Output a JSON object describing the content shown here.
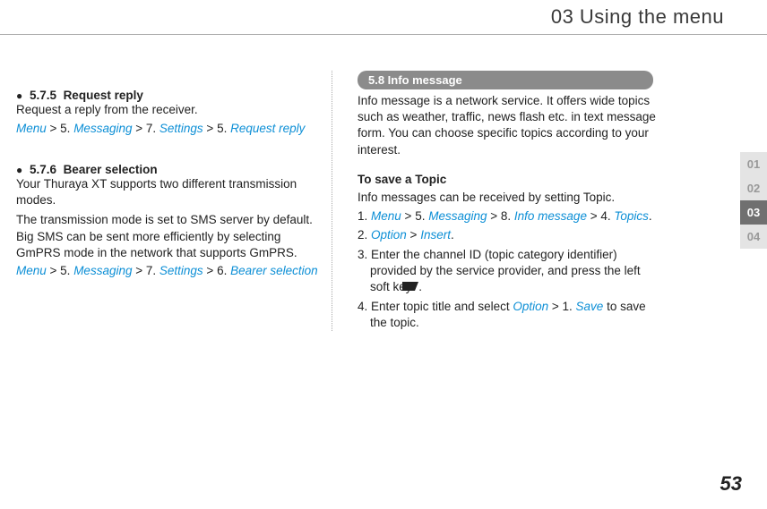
{
  "header": {
    "title": "03 Using the menu"
  },
  "left": {
    "sec575": {
      "num": "5.7.5",
      "title": "Request reply",
      "body": "Request a reply from the receiver.",
      "path": {
        "p1": "Menu",
        "s1": " > ",
        "n1": "5. ",
        "p2": "Messaging",
        "s2": " > ",
        "n2": "7. ",
        "p3": "Settings",
        "s3": " > ",
        "n3": "5. ",
        "p4": "Request reply"
      }
    },
    "sec576": {
      "num": "5.7.6",
      "title": "Bearer selection",
      "body1": "Your Thuraya XT supports two different transmission modes.",
      "body2": "The transmission mode is set to SMS server by default. Big SMS can be sent more efficiently by selecting GmPRS mode in the network that supports GmPRS.",
      "path": {
        "p1": "Menu",
        "s1": " > ",
        "n1": "5. ",
        "p2": "Messaging",
        "s2": " > ",
        "n2": "7. ",
        "p3": "Settings",
        "s3": " > ",
        "n3": "6. ",
        "p4": "Bearer selection"
      }
    }
  },
  "right": {
    "pill": "5.8  Info message",
    "intro": "Info message is a network service. It offers wide topics such as weather, traffic, news flash etc. in text message form. You can choose specific topics according to your interest.",
    "subhead": "To save a Topic",
    "lead": "Info messages can be received by setting Topic.",
    "step1": {
      "n": "1. ",
      "p1": "Menu",
      "s1": " > ",
      "n1": "5. ",
      "p2": "Messaging",
      "s2": " > ",
      "n2": "8. ",
      "p3": "Info message",
      "s3": " > ",
      "n3": "4. ",
      "p4": "Topics",
      "end": "."
    },
    "step2": {
      "n": "2. ",
      "p1": "Option",
      "s1": " > ",
      "p2": "Insert",
      "end": "."
    },
    "step3a": "3. Enter the channel ID (topic category identifier) provided by the service provider, and press the left soft key ",
    "step3b": ".",
    "step4": {
      "n": "4. ",
      "pre": "Enter topic title and select ",
      "p1": "Option",
      "s1": " > ",
      "n1": "1. ",
      "p2": "Save",
      "post": " to save the topic."
    }
  },
  "tabs": {
    "t1": "01",
    "t2": "02",
    "t3": "03",
    "t4": "04"
  },
  "page": "53"
}
